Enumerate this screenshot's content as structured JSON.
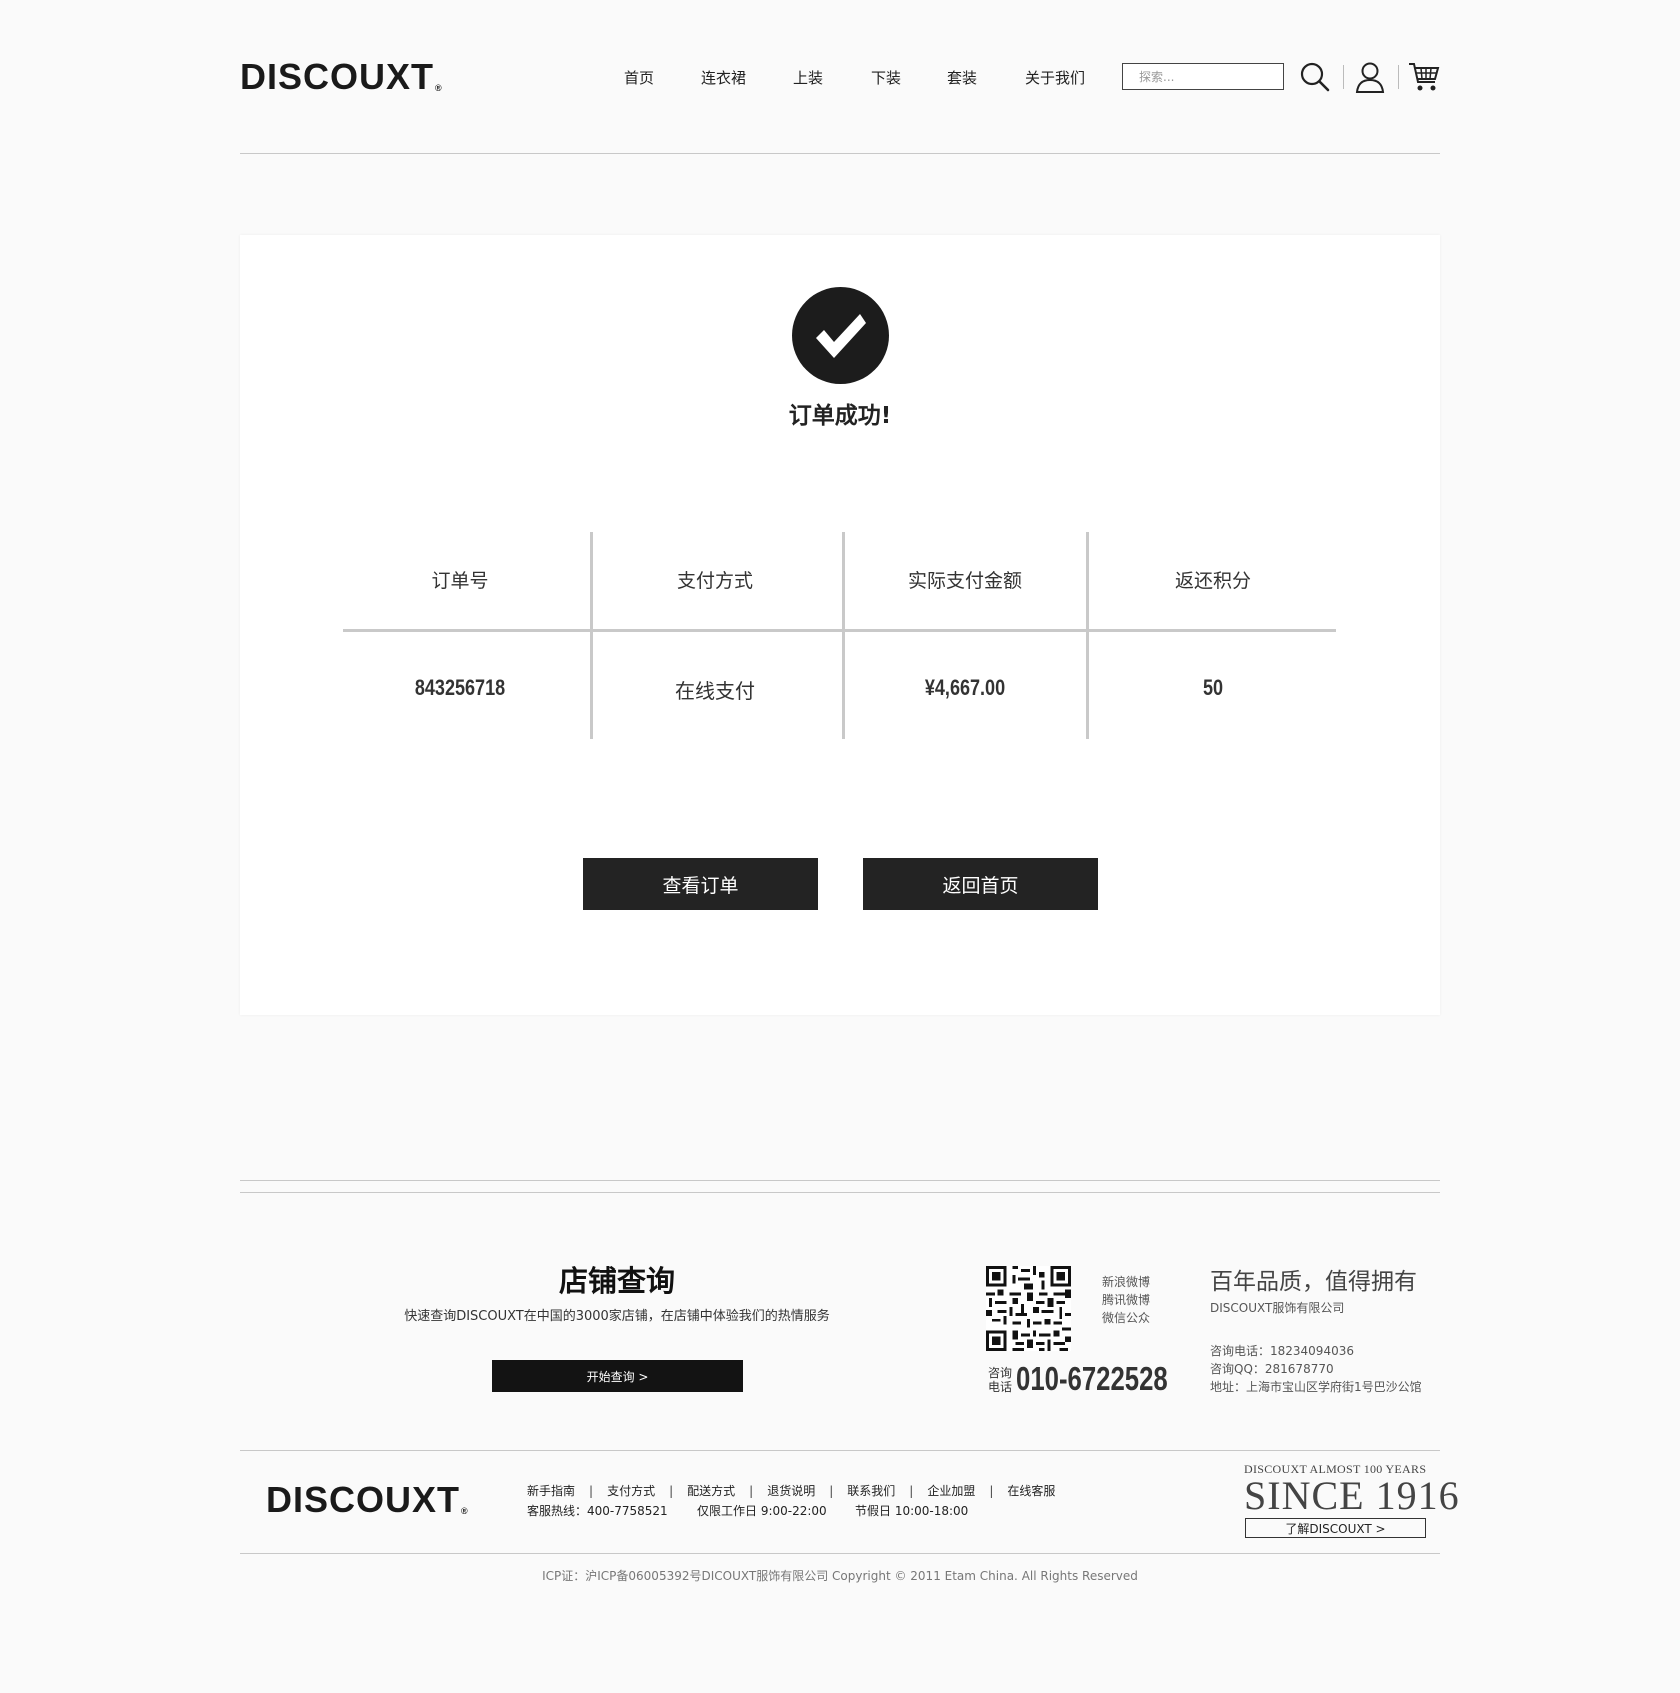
{
  "header": {
    "logo": "DISCOUXT",
    "logo_mark": "®",
    "nav": [
      "首页",
      "连衣裙",
      "上装",
      "下装",
      "套装",
      "关于我们"
    ],
    "search_placeholder": "探索...",
    "icons": [
      "search-icon",
      "user-icon",
      "cart-icon"
    ]
  },
  "result": {
    "title": "订单成功!",
    "table": {
      "headers": [
        "订单号",
        "支付方式",
        "实际支付金额",
        "返还积分"
      ],
      "values": [
        "843256718",
        "在线支付",
        "¥4,667.00",
        "50"
      ]
    },
    "buttons": {
      "view_order": "查看订单",
      "back_home": "返回首页"
    }
  },
  "footer": {
    "store": {
      "title": "店铺查询",
      "desc": "快速查询DISCOUXT在中国的3000家店铺，在店铺中体验我们的热情服务",
      "button": "开始查询  >"
    },
    "social": [
      "新浪微博",
      "腾讯微博",
      "微信公众"
    ],
    "consult_label": [
      "咨询",
      "电话"
    ],
    "hotline": "010-6722528",
    "quality": "百年品质，值得拥有",
    "company": "DISCOUXT服饰有限公司",
    "phone": "咨询电话：18234094036",
    "qq": "咨询QQ：281678770",
    "address": "地址：上海市宝山区学府街1号巴沙公馆",
    "links": [
      "新手指南",
      "支付方式",
      "配送方式",
      "退货说明",
      "联系我们",
      "企业加盟",
      "在线客服"
    ],
    "service_hotline": "客服热线：400-7758521",
    "work_hours": "仅限工作日 9:00-22:00",
    "holiday_hours": "节假日 10:00-18:00",
    "since_small": "DISCOUXT ALMOST 100 YEARS",
    "since_big": "SINCE 1916",
    "about_button": "了解DISCOUXT >",
    "copyright": "ICP证：沪ICP备06005392号DICOUXT服饰有限公司 Copyright © 2011 Etam China. All Rights Reserved"
  },
  "colors": {
    "accent": "#232323",
    "line": "#c9c9c9",
    "background": "#fafafa"
  }
}
